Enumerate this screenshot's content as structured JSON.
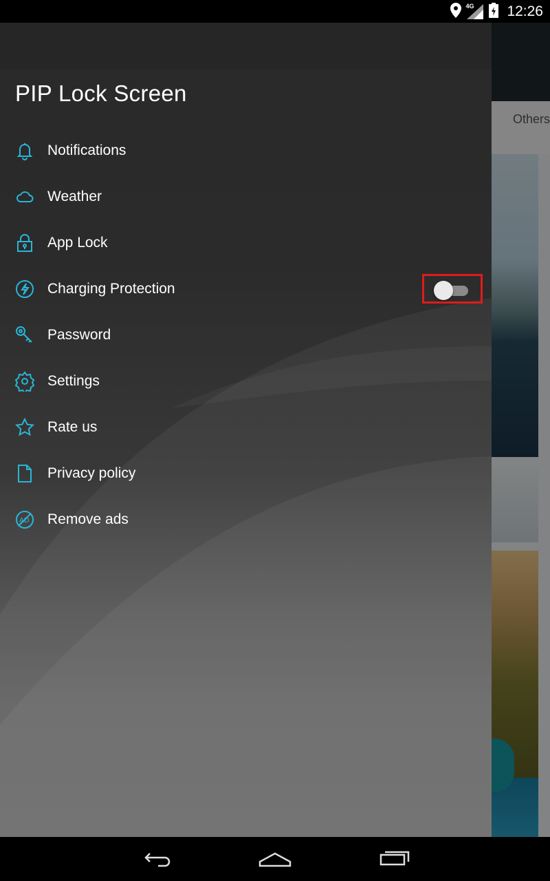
{
  "status_bar": {
    "time": "12:26",
    "network": "4G",
    "icons": [
      "location-icon",
      "signal-icon",
      "battery-icon"
    ]
  },
  "app_behind": {
    "tab_partial": "Others"
  },
  "drawer": {
    "title": "PIP Lock Screen",
    "items": [
      {
        "label": "Notifications",
        "icon": "bell-icon"
      },
      {
        "label": "Weather",
        "icon": "cloud-icon"
      },
      {
        "label": "App Lock",
        "icon": "lock-icon"
      },
      {
        "label": "Charging Protection",
        "icon": "lightning-icon",
        "toggle": false
      },
      {
        "label": "Password",
        "icon": "key-icon"
      },
      {
        "label": "Settings",
        "icon": "gear-icon"
      },
      {
        "label": "Rate us",
        "icon": "star-icon"
      },
      {
        "label": "Privacy policy",
        "icon": "document-icon"
      },
      {
        "label": "Remove ads",
        "icon": "no-ads-icon"
      }
    ]
  },
  "colors": {
    "accent": "#29b6d6",
    "highlight_box": "#e01b1b"
  },
  "nav_bar": {
    "buttons": [
      "back-icon",
      "home-icon",
      "recents-icon"
    ]
  }
}
